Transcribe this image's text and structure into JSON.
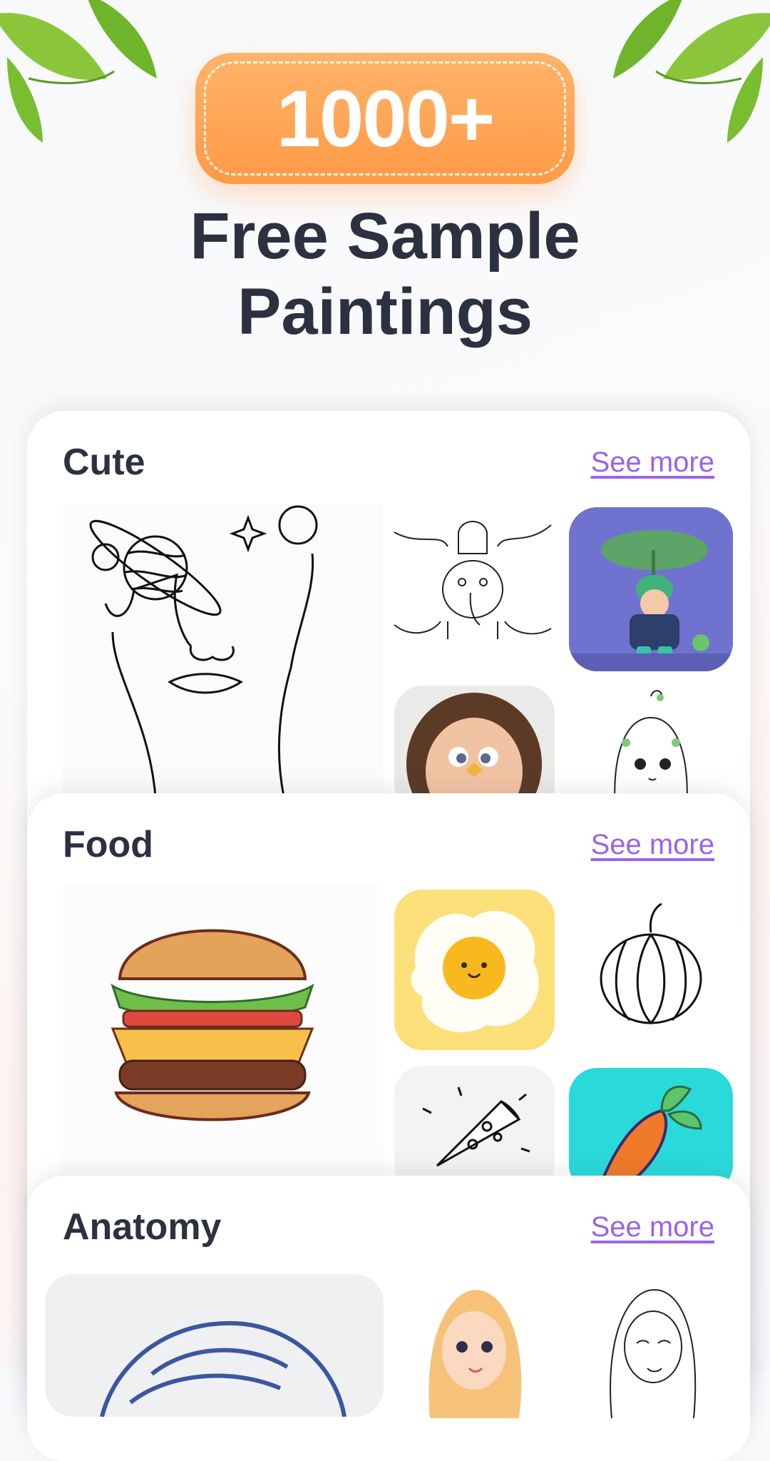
{
  "badge": {
    "text": "1000+"
  },
  "headline": {
    "line1": "Free Sample",
    "line2": "Paintings"
  },
  "categories": [
    {
      "title": "Cute",
      "see_more": "See more"
    },
    {
      "title": "Food",
      "see_more": "See more"
    },
    {
      "title": "Anatomy",
      "see_more": "See more"
    }
  ],
  "colors": {
    "accent": "#9a63e8",
    "badge": "#ff9a45",
    "heading": "#2b3140"
  }
}
